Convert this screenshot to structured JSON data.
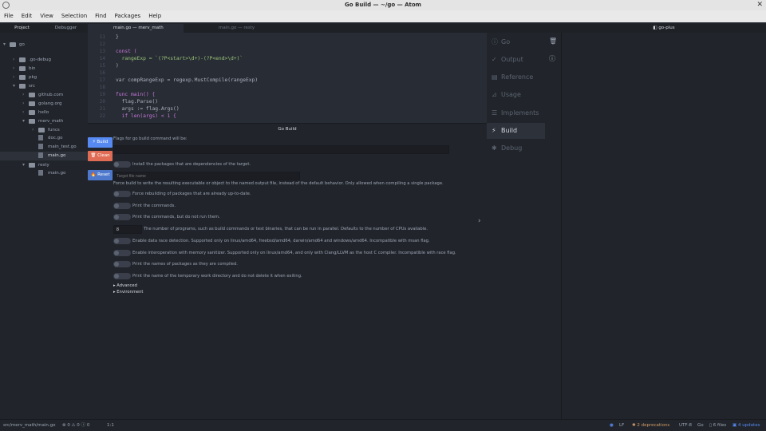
{
  "window": {
    "title": "Go Build — ~/go — Atom"
  },
  "menu": [
    "File",
    "Edit",
    "View",
    "Selection",
    "Find",
    "Packages",
    "Help"
  ],
  "tree": {
    "tabs": [
      "Project",
      "Debugger"
    ],
    "items": [
      {
        "label": "go",
        "type": "folder",
        "depth": 0,
        "open": true
      },
      {
        "label": ".go-debug",
        "type": "folder",
        "depth": 1
      },
      {
        "label": "bin",
        "type": "folder",
        "depth": 1
      },
      {
        "label": "pkg",
        "type": "folder",
        "depth": 1
      },
      {
        "label": "src",
        "type": "folder",
        "depth": 1,
        "open": true
      },
      {
        "label": "github.com",
        "type": "folder",
        "depth": 2
      },
      {
        "label": "golang.org",
        "type": "folder",
        "depth": 2
      },
      {
        "label": "hello",
        "type": "folder",
        "depth": 2
      },
      {
        "label": "merv_math",
        "type": "folder",
        "depth": 2,
        "open": true
      },
      {
        "label": "funcs",
        "type": "folder",
        "depth": 3
      },
      {
        "label": "doc.go",
        "type": "file",
        "depth": 3
      },
      {
        "label": "main_test.go",
        "type": "file",
        "depth": 3
      },
      {
        "label": "main.go",
        "type": "file",
        "depth": 3,
        "selected": true
      },
      {
        "label": "resty",
        "type": "folder",
        "depth": 2,
        "open": true
      },
      {
        "label": "main.go",
        "type": "file",
        "depth": 3
      }
    ]
  },
  "editor": {
    "tabs": [
      "main.go — merv_math",
      "main.go — resty"
    ],
    "lines": [
      {
        "n": "11",
        "code": "}"
      },
      {
        "n": "12",
        "code": ""
      },
      {
        "n": "13",
        "code": "const ("
      },
      {
        "n": "14",
        "code": "  rangeExp = `(?P<start>\\d+)-(?P<end>\\d+)`"
      },
      {
        "n": "15",
        "code": ")"
      },
      {
        "n": "16",
        "code": ""
      },
      {
        "n": "17",
        "code": "var compRangeExp = regexp.MustCompile(rangeExp)"
      },
      {
        "n": "18",
        "code": ""
      },
      {
        "n": "19",
        "code": "func main() {"
      },
      {
        "n": "20",
        "code": "  flag.Parse()"
      },
      {
        "n": "21",
        "code": "  args := flag.Args()"
      },
      {
        "n": "22",
        "code": "  if len(args) < 1 {"
      }
    ]
  },
  "build": {
    "title": "Go Build",
    "buttons": {
      "build": "Build",
      "clean": "Clean",
      "reset": "Reset"
    },
    "flags_label": "Flags for go build command will be:",
    "flags_value": "",
    "install_deps": "Install the packages that are dependencies of the target.",
    "target_placeholder": "Target file name",
    "output_desc": "Force build to write the resulting executable or object to the named output file, instead of the default behavior. Only allowed when compiling a single package.",
    "options": [
      "Force rebuilding of packages that are already up-to-date.",
      "Print the commands.",
      "Print the commands, but do not run them."
    ],
    "parallel_value": "8",
    "parallel_desc": "The number of programs, such as build commands or test binaries, that can be run in parallel. Defaults to the number of CPUs available.",
    "options2": [
      "Enable data race detection. Supported only on linux/amd64, freebsd/amd64, darwin/amd64 and windows/amd64. Incompatible with msan flag.",
      "Enable interoperation with memory sanitizer. Supported only on linux/amd64, and only with Clang/LLVM as the host C compiler. Incompatible with race flag.",
      "Print the names of packages as they are compiled.",
      "Print the name of the temporary work directory and do not delete it when exiting."
    ],
    "sections": [
      "Advanced",
      "Environment"
    ]
  },
  "goplus": {
    "title": "go-plus",
    "nav": [
      {
        "label": "Go",
        "icon": "info-icon"
      },
      {
        "label": "Output",
        "icon": "check-icon"
      },
      {
        "label": "Reference",
        "icon": "book-icon"
      },
      {
        "label": "Usage",
        "icon": "telescope-icon"
      },
      {
        "label": "Implements",
        "icon": "checklist-icon"
      },
      {
        "label": "Build",
        "icon": "zap-icon",
        "active": true
      },
      {
        "label": "Debug",
        "icon": "bug-icon"
      }
    ]
  },
  "status": {
    "path": "src/merv_math/main.go",
    "errors": "0",
    "warnings": "0",
    "infos": "0",
    "cursor": "1:1",
    "line_ending": "LF",
    "deprecations": "2 deprecations",
    "encoding": "UTF-8",
    "grammar": "Go",
    "files": "6 files",
    "updates": "4 updates"
  }
}
